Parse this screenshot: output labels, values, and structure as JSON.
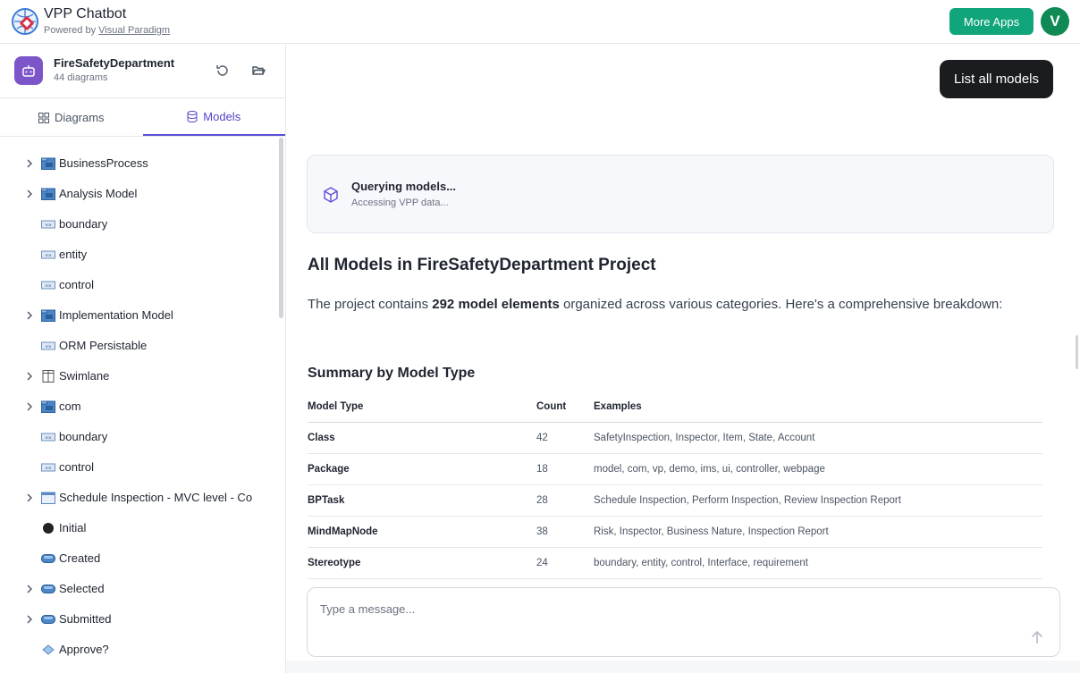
{
  "app": {
    "title": "VPP Chatbot",
    "powered_prefix": "Powered by ",
    "powered_link": "Visual Paradigm",
    "more_apps": "More Apps",
    "avatar_letter": "V"
  },
  "project": {
    "name": "FireSafetyDepartment",
    "count": "44 diagrams"
  },
  "tabs": [
    {
      "label": "Diagrams",
      "icon": "grid-icon",
      "active": false
    },
    {
      "label": "Models",
      "icon": "database-icon",
      "active": true
    }
  ],
  "tree": [
    {
      "label": "BusinessProcess",
      "icon": "package-icon",
      "expandable": true
    },
    {
      "label": "Analysis Model",
      "icon": "package-icon",
      "expandable": true
    },
    {
      "label": "boundary",
      "icon": "stereotype-icon",
      "expandable": false
    },
    {
      "label": "entity",
      "icon": "stereotype-icon",
      "expandable": false
    },
    {
      "label": "control",
      "icon": "stereotype-icon",
      "expandable": false
    },
    {
      "label": "Implementation Model",
      "icon": "package-icon",
      "expandable": true
    },
    {
      "label": "ORM Persistable",
      "icon": "stereotype-icon",
      "expandable": false
    },
    {
      "label": "Swimlane",
      "icon": "swimlane-icon",
      "expandable": true
    },
    {
      "label": "com",
      "icon": "package-icon",
      "expandable": true
    },
    {
      "label": "boundary",
      "icon": "stereotype-icon",
      "expandable": false
    },
    {
      "label": "control",
      "icon": "stereotype-icon",
      "expandable": false
    },
    {
      "label": "Schedule Inspection - MVC level - Co",
      "icon": "diagram-icon",
      "expandable": true
    },
    {
      "label": "Initial",
      "icon": "initial-node-icon",
      "expandable": false
    },
    {
      "label": "Created",
      "icon": "state-icon",
      "expandable": false
    },
    {
      "label": "Selected",
      "icon": "state-icon",
      "expandable": true
    },
    {
      "label": "Submitted",
      "icon": "state-icon",
      "expandable": true
    },
    {
      "label": "Approve?",
      "icon": "decision-icon",
      "expandable": false
    }
  ],
  "chat": {
    "user_message": "List all models",
    "query_title": "Querying models...",
    "query_sub": "Accessing VPP data...",
    "heading": "All Models in FireSafetyDepartment Project",
    "intro_before": "The project contains ",
    "intro_bold": "292 model elements",
    "intro_after": " organized across various categories. Here's a comprehensive breakdown:",
    "summary_heading": "Summary by Model Type",
    "table_headers": [
      "Model Type",
      "Count",
      "Examples"
    ],
    "table_rows": [
      {
        "type": "Class",
        "count": "42",
        "examples": "SafetyInspection, Inspector, Item, State, Account"
      },
      {
        "type": "Package",
        "count": "18",
        "examples": "model, com, vp, demo, ims, ui, controller, webpage"
      },
      {
        "type": "BPTask",
        "count": "28",
        "examples": "Schedule Inspection, Perform Inspection, Review Inspection Report"
      },
      {
        "type": "MindMapNode",
        "count": "38",
        "examples": "Risk, Inspector, Business Nature, Inspection Report"
      },
      {
        "type": "Stereotype",
        "count": "24",
        "examples": "boundary, entity, control, Interface, requirement"
      }
    ],
    "input_placeholder": "Type a message..."
  },
  "colors": {
    "accent": "#5b50d6",
    "more_apps_bg": "#10a57a",
    "avatar_bg": "#0f8a55",
    "user_bubble": "#1b1c20"
  }
}
